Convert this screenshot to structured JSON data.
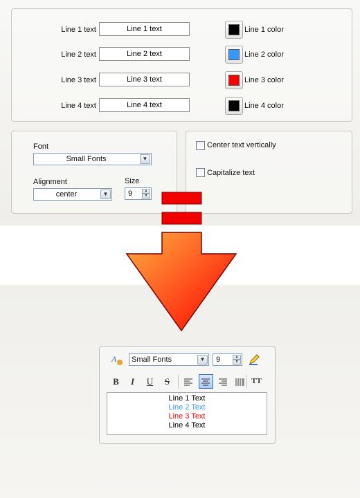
{
  "lines": [
    {
      "label": "Line 1 text",
      "value": "Line 1 text",
      "color_label": "Line 1 color",
      "color": "#000000"
    },
    {
      "label": "Line 2 text",
      "value": "Line 2 text",
      "color_label": "Line 2 color",
      "color": "#3399ff"
    },
    {
      "label": "Line 3 text",
      "value": "Line 3 text",
      "color_label": "Line 3 color",
      "color": "#ff0000"
    },
    {
      "label": "Line 4 text",
      "value": "Line 4 text",
      "color_label": "Line 4 color",
      "color": "#000000"
    }
  ],
  "font_panel": {
    "font_label": "Font",
    "font_value": "Small Fonts",
    "alignment_label": "Alignment",
    "alignment_value": "center",
    "size_label": "Size",
    "size_value": "9"
  },
  "options": {
    "center_vertically": "Center text vertically",
    "capitalize": "Capitalize text"
  },
  "editor": {
    "font_value": "Small Fonts",
    "size_value": "9",
    "bold": "B",
    "italic": "I",
    "underline": "U",
    "strike": "S",
    "caps": "TT",
    "active_alignment": "center",
    "preview": [
      {
        "text": "Line 1 Text",
        "color": "#000000"
      },
      {
        "text": "Line 2 Text",
        "color": "#3399ff"
      },
      {
        "text": "Line 3 Text",
        "color": "#ff0000"
      },
      {
        "text": "Line 4 Text",
        "color": "#000000"
      }
    ]
  },
  "icons": {
    "dropdown": "chevron-down-icon",
    "spin_up": "spin-up-icon",
    "spin_down": "spin-down-icon",
    "font_style": "font-style-icon",
    "edit": "pencil-icon",
    "arrow": "down-arrow-icon"
  },
  "accent": {
    "arrow_top": "#ffa43a",
    "arrow_bottom": "#ff0000",
    "arrow_border": "#7a0000"
  }
}
